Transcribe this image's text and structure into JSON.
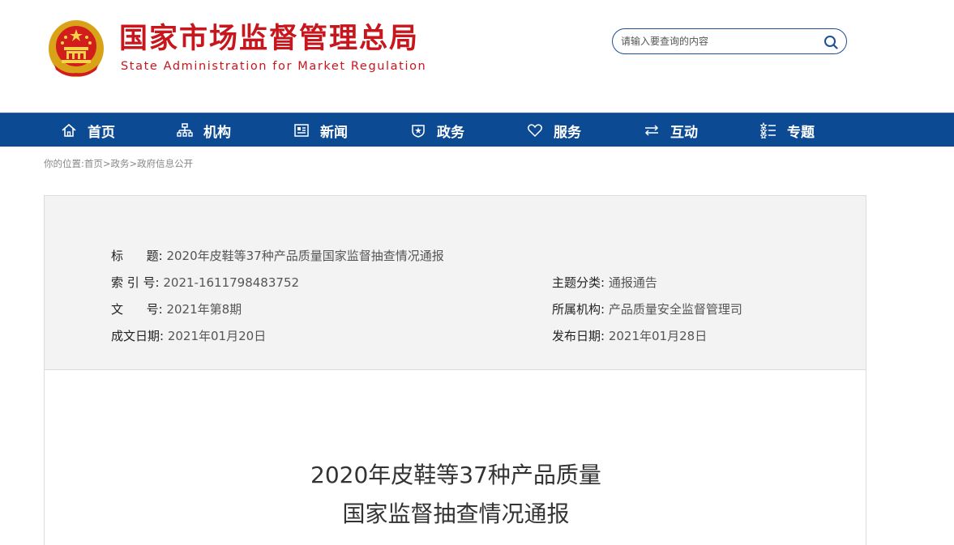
{
  "header": {
    "site_name_cn": "国家市场监督管理总局",
    "site_name_en": "State Administration for Market Regulation",
    "emblem_icon": "national-emblem-icon",
    "search_placeholder": "请输入要查询的内容",
    "search_icon": "search-icon"
  },
  "nav": {
    "items": [
      {
        "label": "首页",
        "icon": "home-icon"
      },
      {
        "label": "机构",
        "icon": "org-chart-icon"
      },
      {
        "label": "新闻",
        "icon": "newspaper-icon"
      },
      {
        "label": "政务",
        "icon": "shield-icon"
      },
      {
        "label": "服务",
        "icon": "heart-icon"
      },
      {
        "label": "互动",
        "icon": "exchange-icon"
      },
      {
        "label": "专题",
        "icon": "star-list-icon"
      }
    ]
  },
  "breadcrumb": {
    "prefix": "你的位置:",
    "items": [
      "首页",
      "政务",
      "政府信息公开"
    ],
    "separator": ">"
  },
  "info": {
    "title_label": "标      题:",
    "title_value": "2020年皮鞋等37种产品质量国家监督抽查情况通报",
    "index_label": "索 引 号:",
    "index_value": "2021-1611798483752",
    "category_label": "主题分类:",
    "category_value": "通报通告",
    "docno_label": "文      号:",
    "docno_value": "2021年第8期",
    "org_label": "所属机构:",
    "org_value": "产品质量安全监督管理司",
    "created_label": "成文日期:",
    "created_value": "2021年01月20日",
    "published_label": "发布日期:",
    "published_value": "2021年01月28日"
  },
  "article": {
    "title_line1": "2020年皮鞋等37种产品质量",
    "title_line2": "国家监督抽查情况通报"
  },
  "colors": {
    "brand_red": "#c8161d",
    "nav_blue": "#0c4a94",
    "info_bg": "#f3f3f3"
  }
}
